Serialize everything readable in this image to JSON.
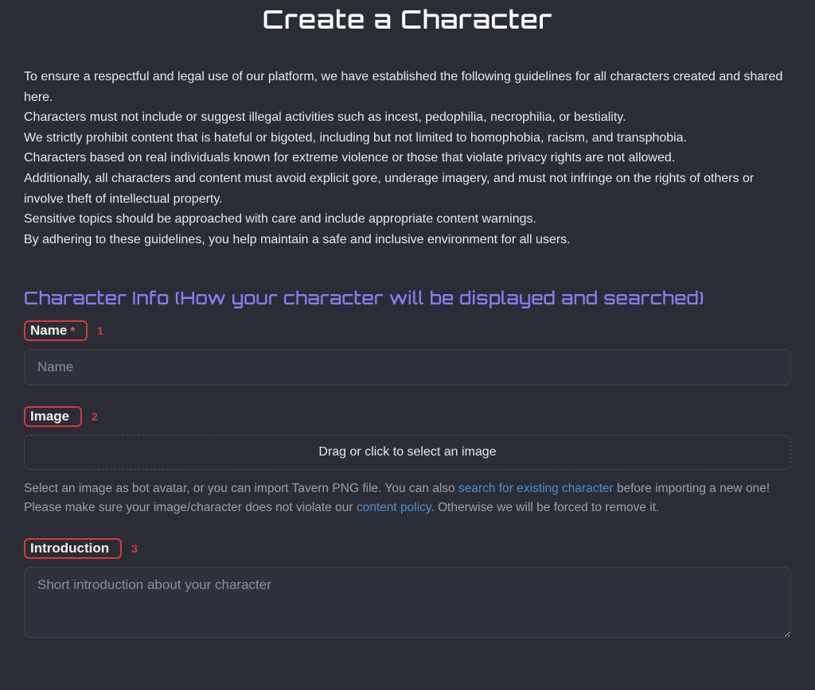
{
  "title": "Create a Character",
  "guidelines": [
    "To ensure a respectful and legal use of our platform, we have established the following guidelines for all characters created and shared here.",
    "Characters must not include or suggest illegal activities such as incest, pedophilia, necrophilia, or bestiality.",
    "We strictly prohibit content that is hateful or bigoted, including but not limited to homophobia, racism, and transphobia.",
    "Characters based on real individuals known for extreme violence or those that violate privacy rights are not allowed.",
    "Additionally, all characters and content must avoid explicit gore, underage imagery, and must not infringe on the rights of others or involve theft of intellectual property.",
    "Sensitive topics should be approached with care and include appropriate content warnings.",
    "By adhering to these guidelines, you help maintain a safe and inclusive environment for all users."
  ],
  "section_heading": "Character Info (How your character will be displayed and searched)",
  "fields": {
    "name": {
      "label": "Name",
      "required_mark": "*",
      "anno": "1",
      "placeholder": "Name"
    },
    "image": {
      "label": "Image",
      "anno": "2",
      "dropzone_text": "Drag or click to select an image",
      "helper_pre": "Select an image as bot avatar, or you can import Tavern PNG file. You can also ",
      "helper_link1": "search for existing character",
      "helper_mid1": " before importing a new one!",
      "helper_line2_pre": "Please make sure your image/character does not violate our ",
      "helper_link2": "content policy",
      "helper_line2_post": ". Otherwise we will be forced to remove it."
    },
    "introduction": {
      "label": "Introduction",
      "anno": "3",
      "placeholder": "Short introduction about your character"
    }
  }
}
